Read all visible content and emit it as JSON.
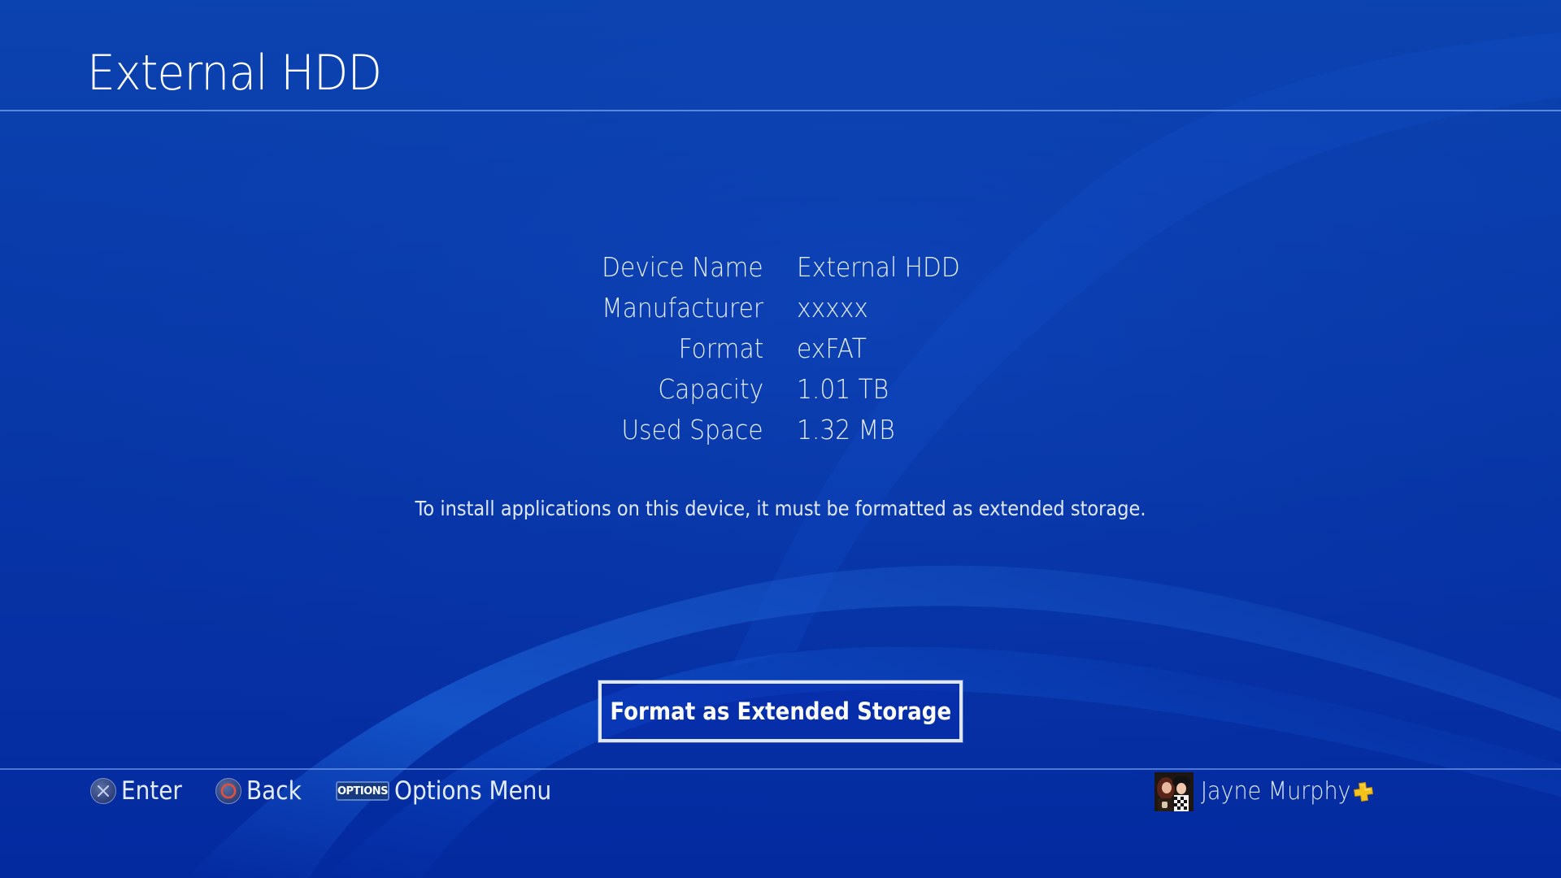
{
  "header": {
    "title": "External HDD"
  },
  "device_info": {
    "rows": [
      {
        "label": "Device Name",
        "value": "External HDD"
      },
      {
        "label": "Manufacturer",
        "value": "xxxxx"
      },
      {
        "label": "Format",
        "value": "exFAT"
      },
      {
        "label": "Capacity",
        "value": "1.01 TB"
      },
      {
        "label": "Used Space",
        "value": "1.32 MB"
      }
    ]
  },
  "notice": "To install applications on this device, it must be formatted as extended storage.",
  "primary_action": {
    "label": "Format as Extended Storage"
  },
  "footer": {
    "hints": [
      {
        "icon": "cross-button-icon",
        "label": "Enter"
      },
      {
        "icon": "circle-button-icon",
        "label": "Back"
      },
      {
        "icon": "options-button-icon",
        "badge": "OPTIONS",
        "label": "Options Menu"
      }
    ],
    "user": {
      "name": "Jayne Murphy",
      "membership_icon": "playstation-plus-icon"
    }
  },
  "colors": {
    "background_top": "#0b43b0",
    "background_bottom": "#042aa0",
    "circle_button": "#e0503a",
    "plus_gold": "#f2c31a"
  }
}
